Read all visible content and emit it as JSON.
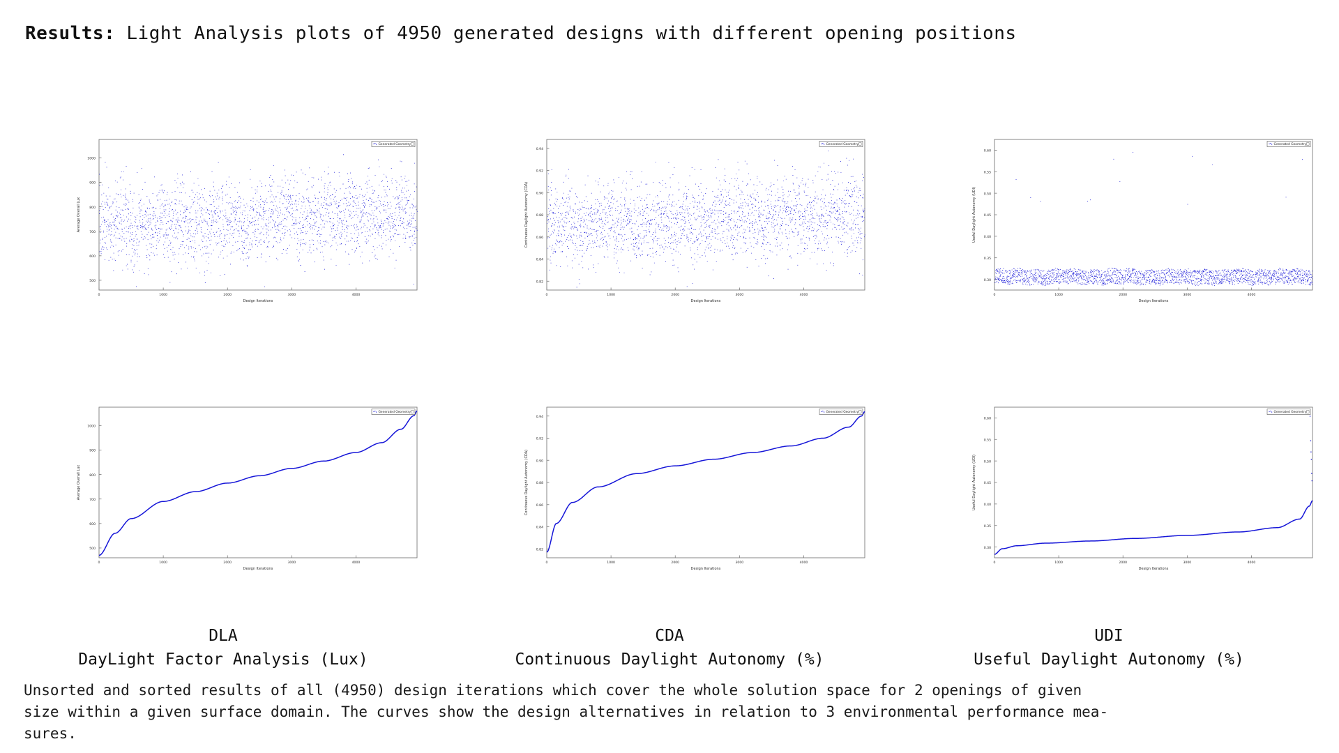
{
  "title": {
    "lead": "Results:",
    "rest": "Light Analysis plots of 4950 generated designs with different opening positions"
  },
  "legend_label": "Generated Geometry",
  "measures": [
    {
      "abbr": "DLA",
      "full": "DayLight Factor Analysis (Lux)"
    },
    {
      "abbr": "CDA",
      "full": "Continuous Daylight Autonomy (%)"
    },
    {
      "abbr": "UDI",
      "full": "Useful Daylight Autonomy  (%)"
    }
  ],
  "caption": {
    "line1": "Unsorted and sorted results of all (4950) design iterations which cover the whole solution space for 2 openings of given",
    "line2": "size within a given surface domain. The curves show the design alternatives in relation to 3 environmental performance mea-",
    "line3": "sures."
  },
  "colors": {
    "data": "#1616d8",
    "frame": "#7a7a7a",
    "axis_text": "#2b2b2b",
    "background": "#ffffff"
  },
  "chart_data": [
    {
      "id": "dla-unsorted",
      "type": "scatter",
      "title": "",
      "xlabel": "Design Iterations",
      "ylabel": "Average Overall Lux",
      "xticks": [
        0,
        1000,
        2000,
        3000,
        4000
      ],
      "yticks": [
        500,
        600,
        700,
        800,
        900,
        1000
      ],
      "xlim": [
        0,
        4950
      ],
      "ylim": [
        460,
        1075
      ],
      "n_points": 4950,
      "grid": false,
      "legend": "Generated Geometry",
      "legend_position": "top-right",
      "description": "Unsorted scatter of average overall lux per design iteration; dense cloud between 600 and 1000 lux with vertical striation bands and a slight upward drift of the lower envelope toward higher iteration numbers."
    },
    {
      "id": "cda-unsorted",
      "type": "scatter",
      "title": "",
      "xlabel": "Design Iterations",
      "ylabel": "Continuous Daylight Autonomy (CDA)",
      "xticks": [
        0,
        1000,
        2000,
        3000,
        4000
      ],
      "yticks": [
        0.82,
        0.84,
        0.86,
        0.88,
        0.9,
        0.92,
        0.94
      ],
      "xlim": [
        0,
        4950
      ],
      "ylim": [
        0.812,
        0.948
      ],
      "n_points": 4950,
      "grid": false,
      "legend": "Generated Geometry",
      "legend_position": "top-right",
      "description": "Unsorted scatter of continuous daylight autonomy; dense band between 0.86 and 0.93 with repeating vertical striations and a rising trend toward the right edge."
    },
    {
      "id": "udi-unsorted",
      "type": "scatter",
      "title": "",
      "xlabel": "Design Iterations",
      "ylabel": "Useful Daylight Autonomy (UDI)",
      "xticks": [
        0,
        1000,
        2000,
        3000,
        4000
      ],
      "yticks": [
        0.3,
        0.35,
        0.4,
        0.45,
        0.5,
        0.55,
        0.6
      ],
      "xlim": [
        0,
        4950
      ],
      "ylim": [
        0.275,
        0.625
      ],
      "n_points": 4950,
      "grid": false,
      "legend": "Generated Geometry",
      "legend_position": "top-right",
      "description": "Unsorted scatter of useful daylight autonomy; very tight horizontal band around 0.30-0.36 with a handful of high outliers up to about 0.61."
    },
    {
      "id": "dla-sorted",
      "type": "line",
      "title": "",
      "xlabel": "Design Iterations",
      "ylabel": "Average Overall Lux",
      "xticks": [
        0,
        1000,
        2000,
        3000,
        4000
      ],
      "yticks": [
        500,
        600,
        700,
        800,
        900,
        1000
      ],
      "xlim": [
        0,
        4950
      ],
      "ylim": [
        460,
        1075
      ],
      "n_points": 4950,
      "grid": false,
      "legend": "Generated Geometry",
      "legend_position": "top-right",
      "x": [
        0,
        250,
        500,
        1000,
        1500,
        2000,
        2500,
        3000,
        3500,
        4000,
        4400,
        4700,
        4900,
        4950
      ],
      "y": [
        470,
        560,
        620,
        690,
        730,
        765,
        795,
        825,
        855,
        890,
        930,
        985,
        1040,
        1060
      ],
      "description": "Sorted ascending curve of average overall lux rising steeply from ~470 lux, flattening through the middle around 700-900 lux and rising sharply again above 1000 lux at the end."
    },
    {
      "id": "cda-sorted",
      "type": "line",
      "title": "",
      "xlabel": "Design Iterations",
      "ylabel": "Continuous Daylight Autonomy (CDA)",
      "xticks": [
        0,
        1000,
        2000,
        3000,
        4000
      ],
      "yticks": [
        0.82,
        0.84,
        0.86,
        0.88,
        0.9,
        0.92,
        0.94
      ],
      "xlim": [
        0,
        4950
      ],
      "ylim": [
        0.812,
        0.948
      ],
      "n_points": 4950,
      "grid": false,
      "legend": "Generated Geometry",
      "legend_position": "top-right",
      "x": [
        0,
        150,
        400,
        800,
        1400,
        2000,
        2600,
        3200,
        3800,
        4300,
        4700,
        4900,
        4950
      ],
      "y": [
        0.817,
        0.843,
        0.862,
        0.876,
        0.888,
        0.895,
        0.901,
        0.907,
        0.913,
        0.92,
        0.93,
        0.94,
        0.944
      ],
      "description": "Sorted ascending curve of continuous daylight autonomy climbing steeply from 0.82, plateauing near 0.89-0.91 and rising again to ~0.944."
    },
    {
      "id": "udi-sorted",
      "type": "line",
      "title": "",
      "xlabel": "Design Iterations",
      "ylabel": "Useful Daylight Autonomy (UDI)",
      "xticks": [
        0,
        1000,
        2000,
        3000,
        4000
      ],
      "yticks": [
        0.3,
        0.35,
        0.4,
        0.45,
        0.5,
        0.55,
        0.6
      ],
      "xlim": [
        0,
        4950
      ],
      "ylim": [
        0.275,
        0.625
      ],
      "n_points": 4950,
      "grid": false,
      "legend": "Generated Geometry",
      "legend_position": "top-right",
      "x": [
        0,
        120,
        350,
        800,
        1500,
        2200,
        3000,
        3800,
        4400,
        4750,
        4900,
        4950
      ],
      "y": [
        0.283,
        0.296,
        0.303,
        0.309,
        0.314,
        0.32,
        0.327,
        0.335,
        0.345,
        0.365,
        0.395,
        0.408
      ],
      "description": "Sorted ascending curve of useful daylight autonomy, nearly flat around 0.30-0.34 across most iterations with a sharp upturn at the right end plus a few isolated outlier points near 0.55-0.60."
    }
  ]
}
